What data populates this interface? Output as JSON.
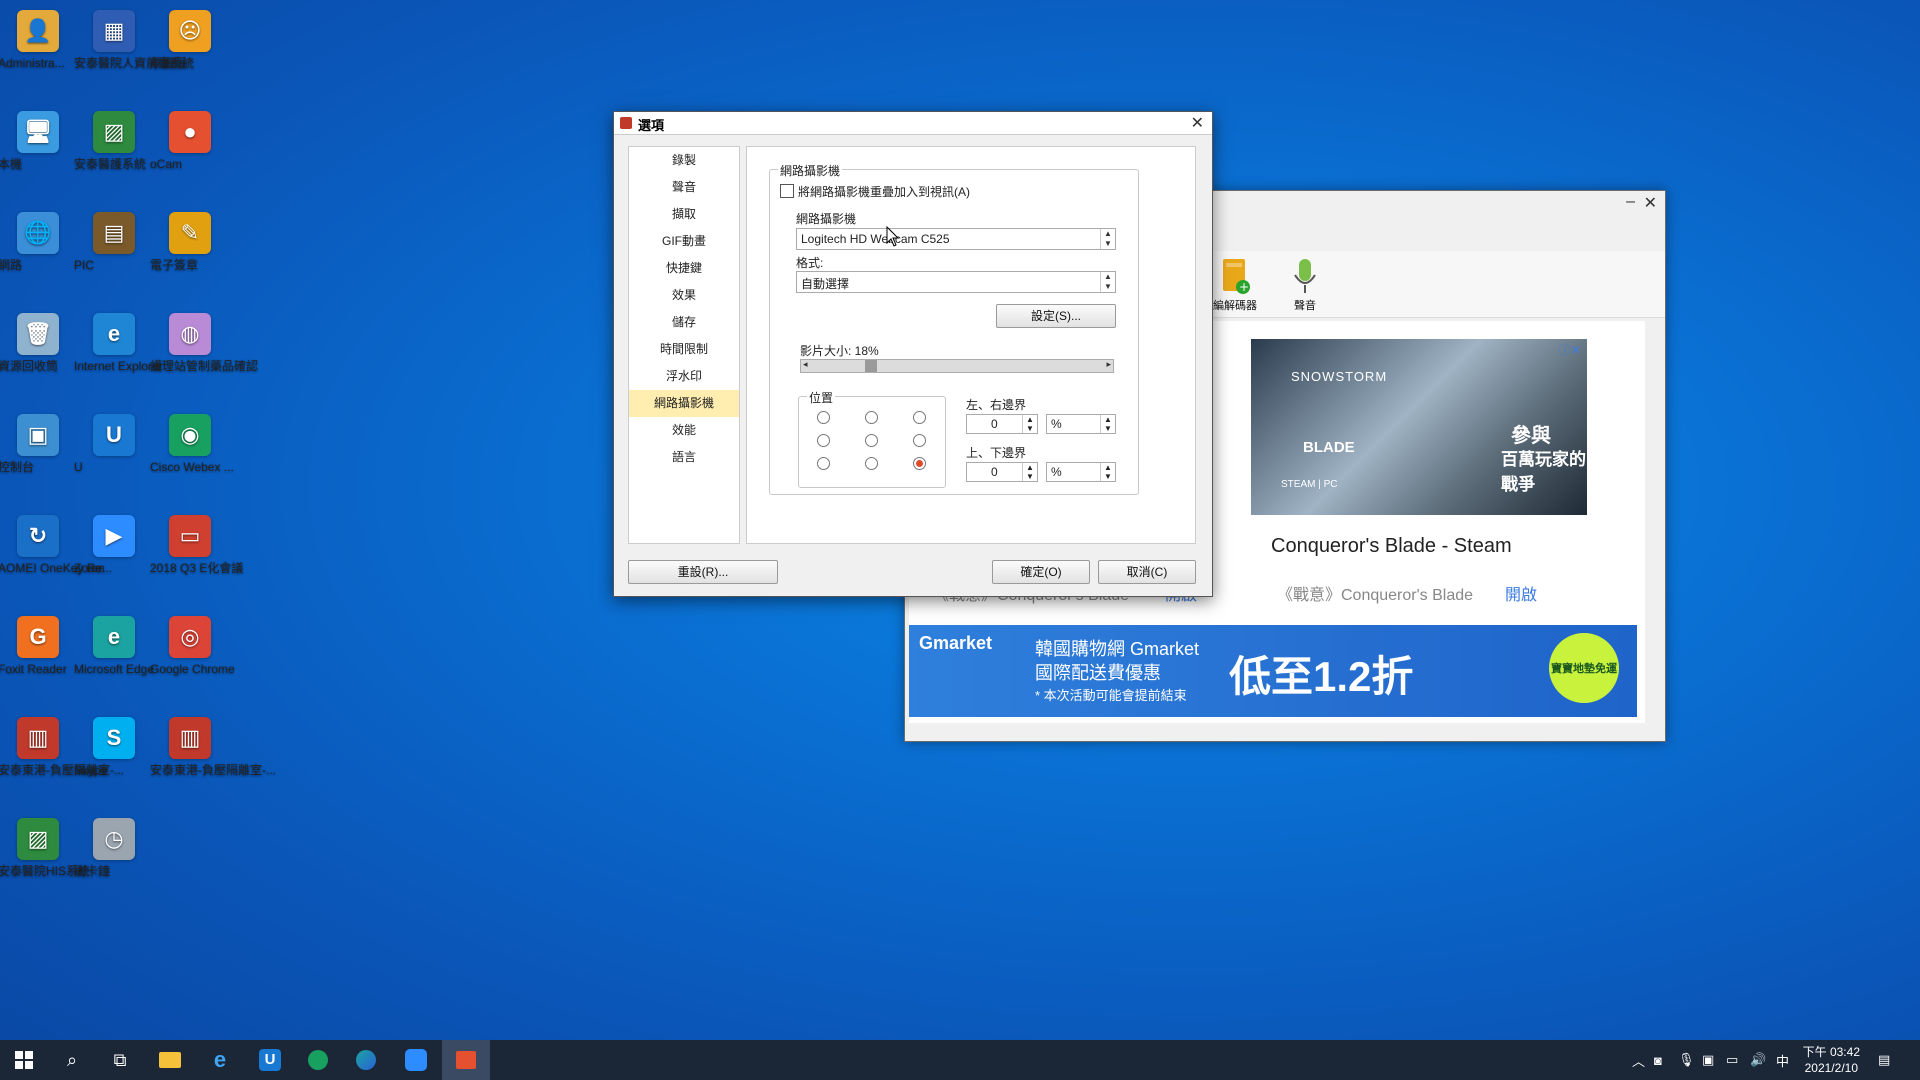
{
  "desktop": {
    "icons": [
      {
        "label": "Administra...",
        "glyph": "👤",
        "color": "#e3a93a"
      },
      {
        "label": "安泰醫院人資前臺系統",
        "glyph": "▦",
        "color": "#2f5db3"
      },
      {
        "label": "單機版",
        "glyph": "☹",
        "color": "#f0a020"
      },
      {
        "label": "本機",
        "glyph": "🖥",
        "color": "#3a9be0"
      },
      {
        "label": "安泰醫護系統",
        "glyph": "▨",
        "color": "#2d8a3e"
      },
      {
        "label": "oCam",
        "glyph": "●",
        "color": "#e55030"
      },
      {
        "label": "網路",
        "glyph": "🌐",
        "color": "#3a8fd8"
      },
      {
        "label": "PIC",
        "glyph": "▤",
        "color": "#7a5a2a"
      },
      {
        "label": "電子簽章",
        "glyph": "✎",
        "color": "#e0a010"
      },
      {
        "label": "資源回收筒",
        "glyph": "🗑",
        "color": "#8fb2cf"
      },
      {
        "label": "Internet Explorer",
        "glyph": "e",
        "color": "#1f86d6"
      },
      {
        "label": "護理站管制藥品確認",
        "glyph": "◍",
        "color": "#b98ad6"
      },
      {
        "label": "控制台",
        "glyph": "▣",
        "color": "#3c8fd0"
      },
      {
        "label": "U",
        "glyph": "U",
        "color": "#1978d2"
      },
      {
        "label": "Cisco Webex ...",
        "glyph": "◉",
        "color": "#18a060"
      },
      {
        "label": "AOMEI OneKey Re...",
        "glyph": "↻",
        "color": "#1a6fc6"
      },
      {
        "label": "Zoom",
        "glyph": "▶",
        "color": "#2d8cff"
      },
      {
        "label": "2018 Q3 E化會議",
        "glyph": "▭",
        "color": "#d04030"
      },
      {
        "label": "Foxit Reader",
        "glyph": "G",
        "color": "#f07020"
      },
      {
        "label": "Microsoft Edge",
        "glyph": "e",
        "color": "#1aa3a0"
      },
      {
        "label": "Google Chrome",
        "glyph": "◎",
        "color": "#db4437"
      },
      {
        "label": "安泰東港-負壓隔離室-...",
        "glyph": "▥",
        "color": "#c0392b"
      },
      {
        "label": "Skype",
        "glyph": "S",
        "color": "#00aff0"
      },
      {
        "label": "安泰東港-負壓隔離室-...",
        "glyph": "▥",
        "color": "#c0392b"
      },
      {
        "label": "安泰醫院HIS系統",
        "glyph": "▨",
        "color": "#2d8a3e"
      },
      {
        "label": "刷卡鐘",
        "glyph": "◷",
        "color": "#9aa5b0"
      }
    ]
  },
  "ocam_window": {
    "tools": [
      {
        "label": "編解碼器"
      },
      {
        "label": "聲音"
      }
    ],
    "ad1": {
      "logo": "SNOWSTORM",
      "blade": "BLADE",
      "steam": "STEAM | PC",
      "line1": "參與",
      "line2": "百萬玩家的戰爭",
      "headline": "Conqueror's Blade - Steam",
      "sub_left": "《戰意》Conqueror's Blade",
      "sub_right": "《戰意》Conqueror's Blade",
      "open": "開啟"
    },
    "ad2": {
      "brand": "Gmarket",
      "title": "韓國購物網 Gmarket",
      "subtitle": "國際配送費優惠",
      "note": "* 本次活動可能會提前結束",
      "promo": "低至1.2折",
      "badge": "寶寶地墊免運"
    }
  },
  "dialog": {
    "title": "選項",
    "nav": [
      {
        "label": "錄製"
      },
      {
        "label": "聲音"
      },
      {
        "label": "擷取"
      },
      {
        "label": "GIF動畫"
      },
      {
        "label": "快捷鍵"
      },
      {
        "label": "效果"
      },
      {
        "label": "儲存"
      },
      {
        "label": "時間限制"
      },
      {
        "label": "浮水印"
      },
      {
        "label": "網路攝影機",
        "selected": true
      },
      {
        "label": "效能"
      },
      {
        "label": "語言"
      }
    ],
    "group_title": "網路攝影機",
    "overlay_checkbox": "將網路攝影機重疊加入到視訊(A)",
    "overlay_checked": false,
    "webcam_label": "網路攝影機",
    "webcam_value": "Logitech HD Webcam C525",
    "format_label": "格式:",
    "format_value": "自動選擇",
    "settings_button": "設定(S)...",
    "size_label": "影片大小: 18%",
    "size_value": 0.18,
    "position_group": "位置",
    "position_selected": 8,
    "lr_margin_label": "左、右邊界",
    "lr_margin_value": "0",
    "lr_unit": "%",
    "tb_margin_label": "上、下邊界",
    "tb_margin_value": "0",
    "tb_unit": "%",
    "reset_button": "重設(R)...",
    "ok_button": "確定(O)",
    "cancel_button": "取消(C)"
  },
  "taskbar": {
    "clock_time": "下午 03:42",
    "clock_date": "2021/2/10",
    "ime": "中"
  }
}
